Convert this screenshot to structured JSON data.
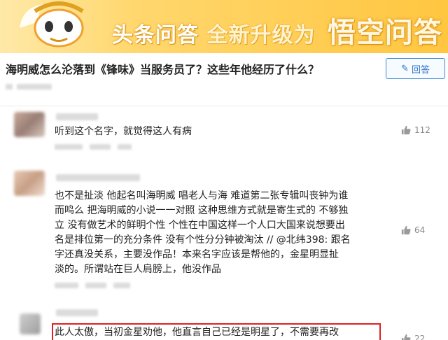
{
  "banner": {
    "part1": "头条问答",
    "part2": "全新升级为",
    "part3": "悟空问答"
  },
  "question": {
    "title": "海明威怎么沦落到《锋味》当服务员了？这些年他经历了什么？",
    "answer_button_label": "回答",
    "answer_button_icon": "pencil-icon"
  },
  "comments": [
    {
      "text_lines": [
        "听到这个名字，就觉得这人有病"
      ],
      "likes": "112"
    },
    {
      "text_lines": [
        "也不是扯淡 他起名叫海明威 唱老人与海 难道第二张专辑叫丧钟为谁",
        "而鸣么 把海明威的小说一一对照 这种思维方式就是寄生式的 不够独",
        "立 没有做艺术的鲜明个性 个性在中国这样一个人口大国来说想要出",
        "名是排位第一的充分条件 没有个性分分钟被淘汰 // @北纬398: 跟名",
        "字还真没关系，主要没作品！本来名字应该是帮他的，金星明显扯",
        "淡的。所谓站在巨人肩膀上，他没作品"
      ],
      "likes": "64"
    },
    {
      "text_lines": [
        "此人太傲，当初金星劝他，他直言自己已经是明星了，不需要再改"
      ],
      "likes": "22"
    }
  ],
  "colors": {
    "accent_blue": "#3e88d6",
    "highlight_red": "#e02020",
    "banner_yellow": "#ffc640"
  }
}
